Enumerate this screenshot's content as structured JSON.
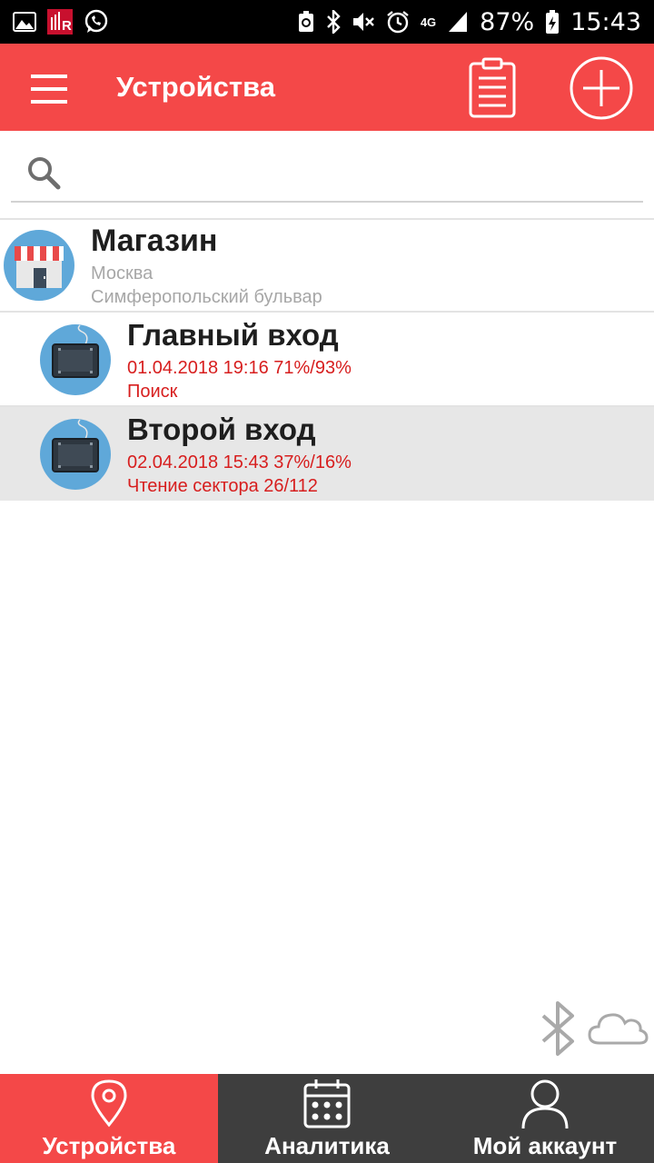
{
  "status_bar": {
    "battery": "87%",
    "time": "15:43",
    "network": "4G"
  },
  "app_bar": {
    "title": "Устройства"
  },
  "search": {
    "placeholder": "",
    "value": ""
  },
  "store": {
    "name": "Магазин",
    "city": "Москва",
    "address": "Симферопольский бульвар"
  },
  "devices": [
    {
      "name": "Главный вход",
      "info": "01.04.2018 19:16 71%/93%",
      "status": "Поиск",
      "selected": false
    },
    {
      "name": "Второй вход",
      "info": "02.04.2018 15:43 37%/16%",
      "status": "Чтение сектора 26/112",
      "selected": true
    }
  ],
  "bottom_nav": {
    "items": [
      {
        "label": "Устройства",
        "icon": "location-pin-icon",
        "active": true
      },
      {
        "label": "Аналитика",
        "icon": "calendar-icon",
        "active": false
      },
      {
        "label": "Мой аккаунт",
        "icon": "user-icon",
        "active": false
      }
    ]
  },
  "colors": {
    "accent": "#f44848",
    "status_text": "#d71e1e",
    "nav_background": "#3e3e3e",
    "selected_row": "#e7e7e7"
  }
}
